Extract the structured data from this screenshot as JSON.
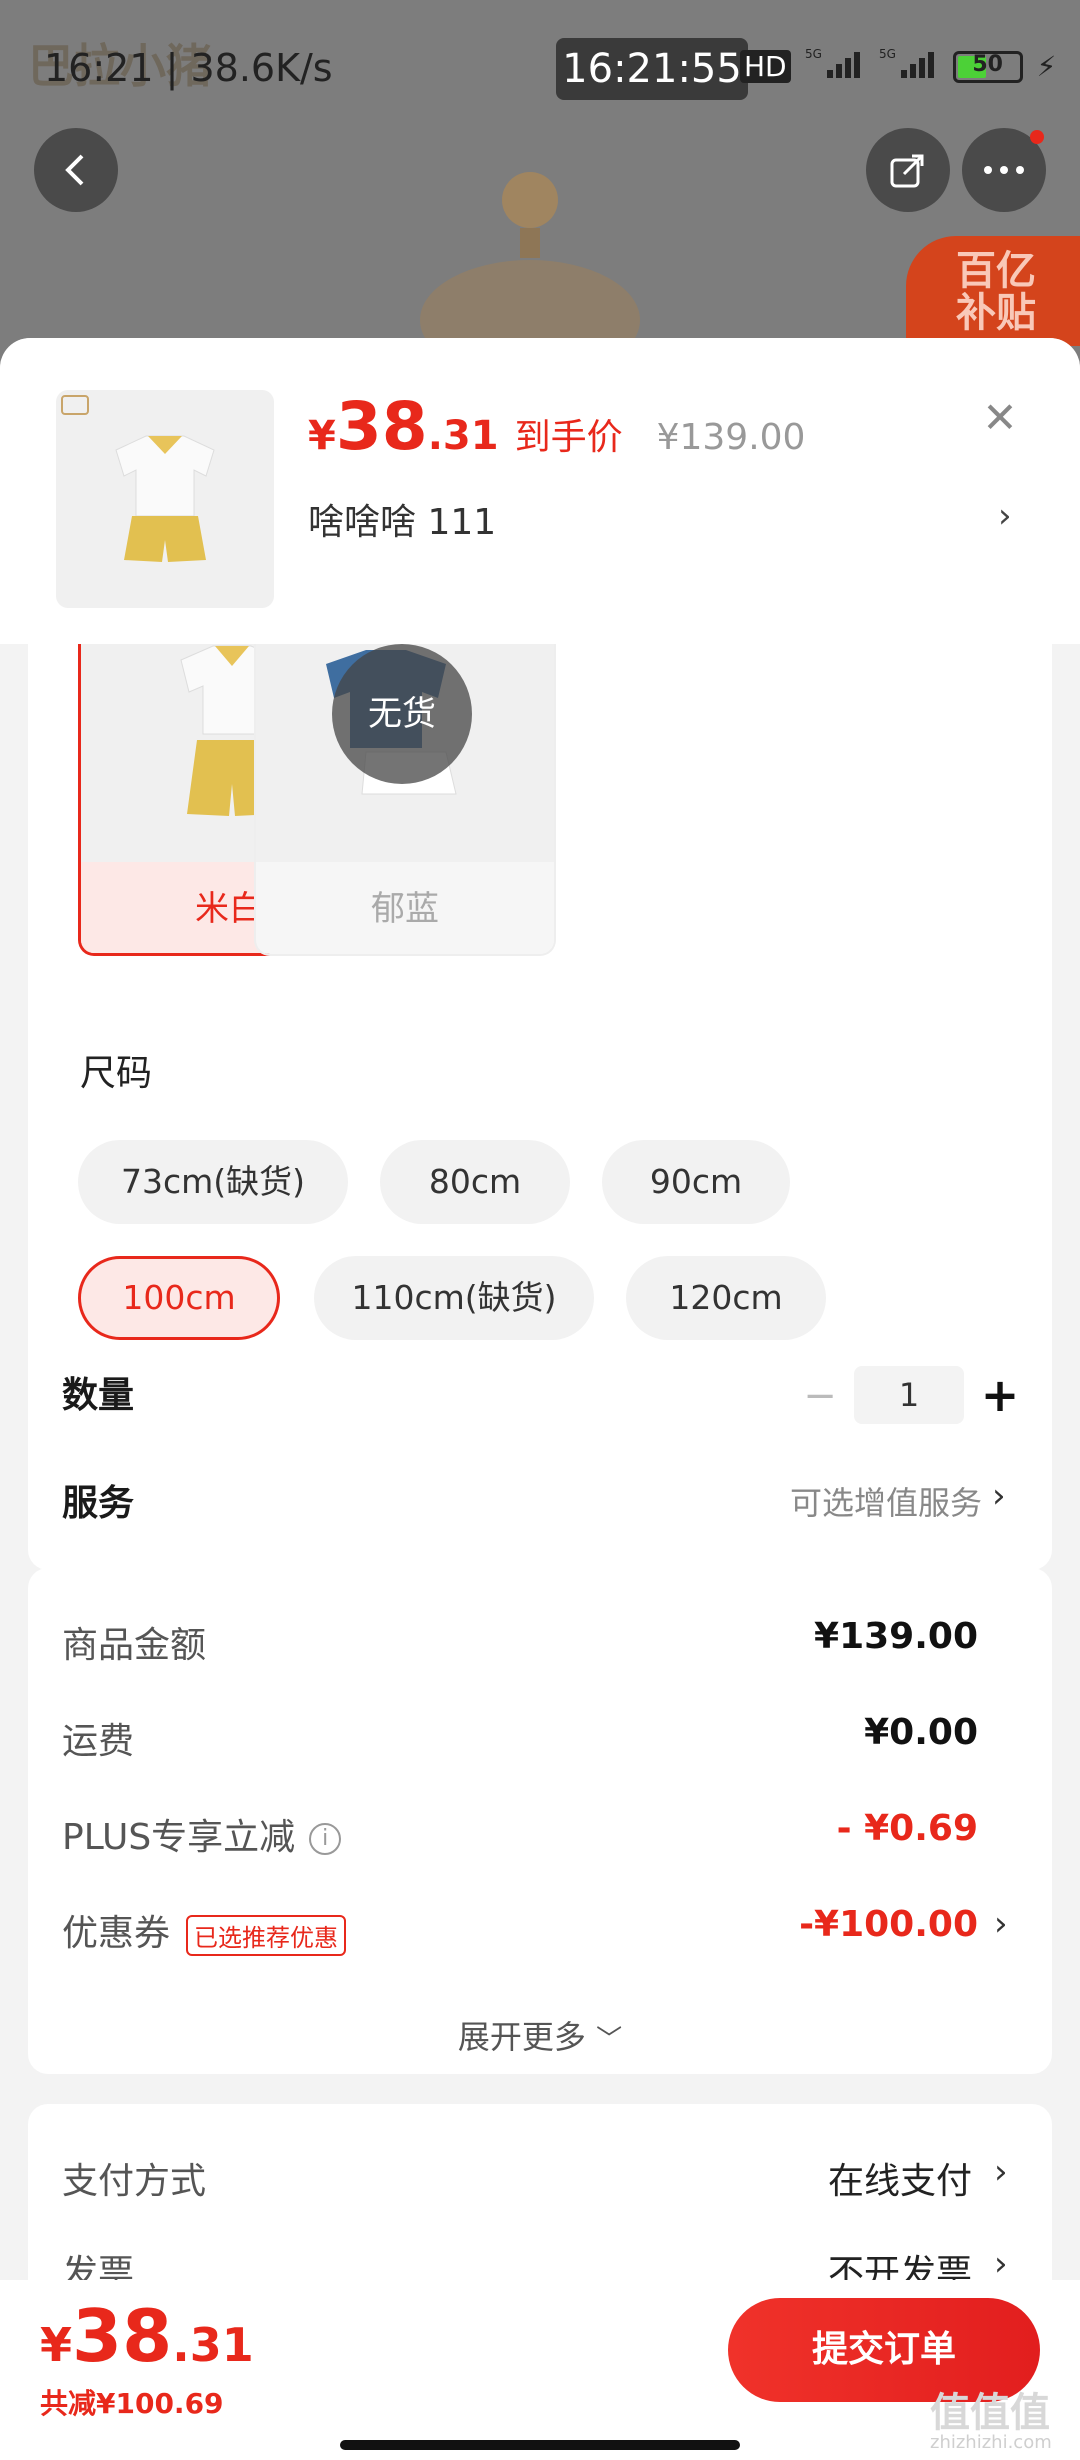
{
  "status_bar": {
    "left": "16:21 | 38.6K/s",
    "time": "16:21:55",
    "battery": "50",
    "network": [
      "HD",
      "5G",
      "5G"
    ]
  },
  "background": {
    "brand_logo": "巴拉小猪",
    "subsidy_badge_line1": "百亿",
    "subsidy_badge_line2": "补贴"
  },
  "header": {
    "price_yen": "¥",
    "price_int": "38",
    "price_dec": ".31",
    "price_label": "到手价",
    "original_price": "¥139.00",
    "selected_variant": "啥啥啥  111"
  },
  "colors": {
    "options": [
      {
        "label": "米白",
        "state": "selected"
      },
      {
        "label": "郁蓝",
        "state": "out_of_stock",
        "badge": "无货"
      }
    ]
  },
  "size": {
    "title": "尺码",
    "options": [
      {
        "label": "73cm(缺货)",
        "state": "out_of_stock"
      },
      {
        "label": "80cm",
        "state": "available"
      },
      {
        "label": "90cm",
        "state": "available"
      },
      {
        "label": "100cm",
        "state": "selected"
      },
      {
        "label": "110cm(缺货)",
        "state": "out_of_stock"
      },
      {
        "label": "120cm",
        "state": "available"
      }
    ]
  },
  "quantity": {
    "label": "数量",
    "value": "1"
  },
  "service": {
    "label": "服务",
    "link": "可选增值服务"
  },
  "costs": {
    "goods_label": "商品金额",
    "goods_value": "¥139.00",
    "shipping_label": "运费",
    "shipping_value": "¥0.00",
    "plus_label": "PLUS专享立减",
    "plus_value": "- ¥0.69",
    "coupon_label": "优惠券",
    "coupon_tag": "已选推荐优惠",
    "coupon_value": "-¥100.00",
    "expand": "展开更多"
  },
  "payment": {
    "method_label": "支付方式",
    "method_value": "在线支付",
    "invoice_label": "发票",
    "invoice_value": "不开发票"
  },
  "bottom": {
    "total_yen": "¥",
    "total_int": "38",
    "total_dec": ".31",
    "saved": "共减¥100.69",
    "submit": "提交订单"
  },
  "watermark": {
    "main": "值值值",
    "sub": "zhizhizhi.com"
  },
  "theme": {
    "accent": "#e8281b",
    "selected_bg": "#fde8e6"
  }
}
